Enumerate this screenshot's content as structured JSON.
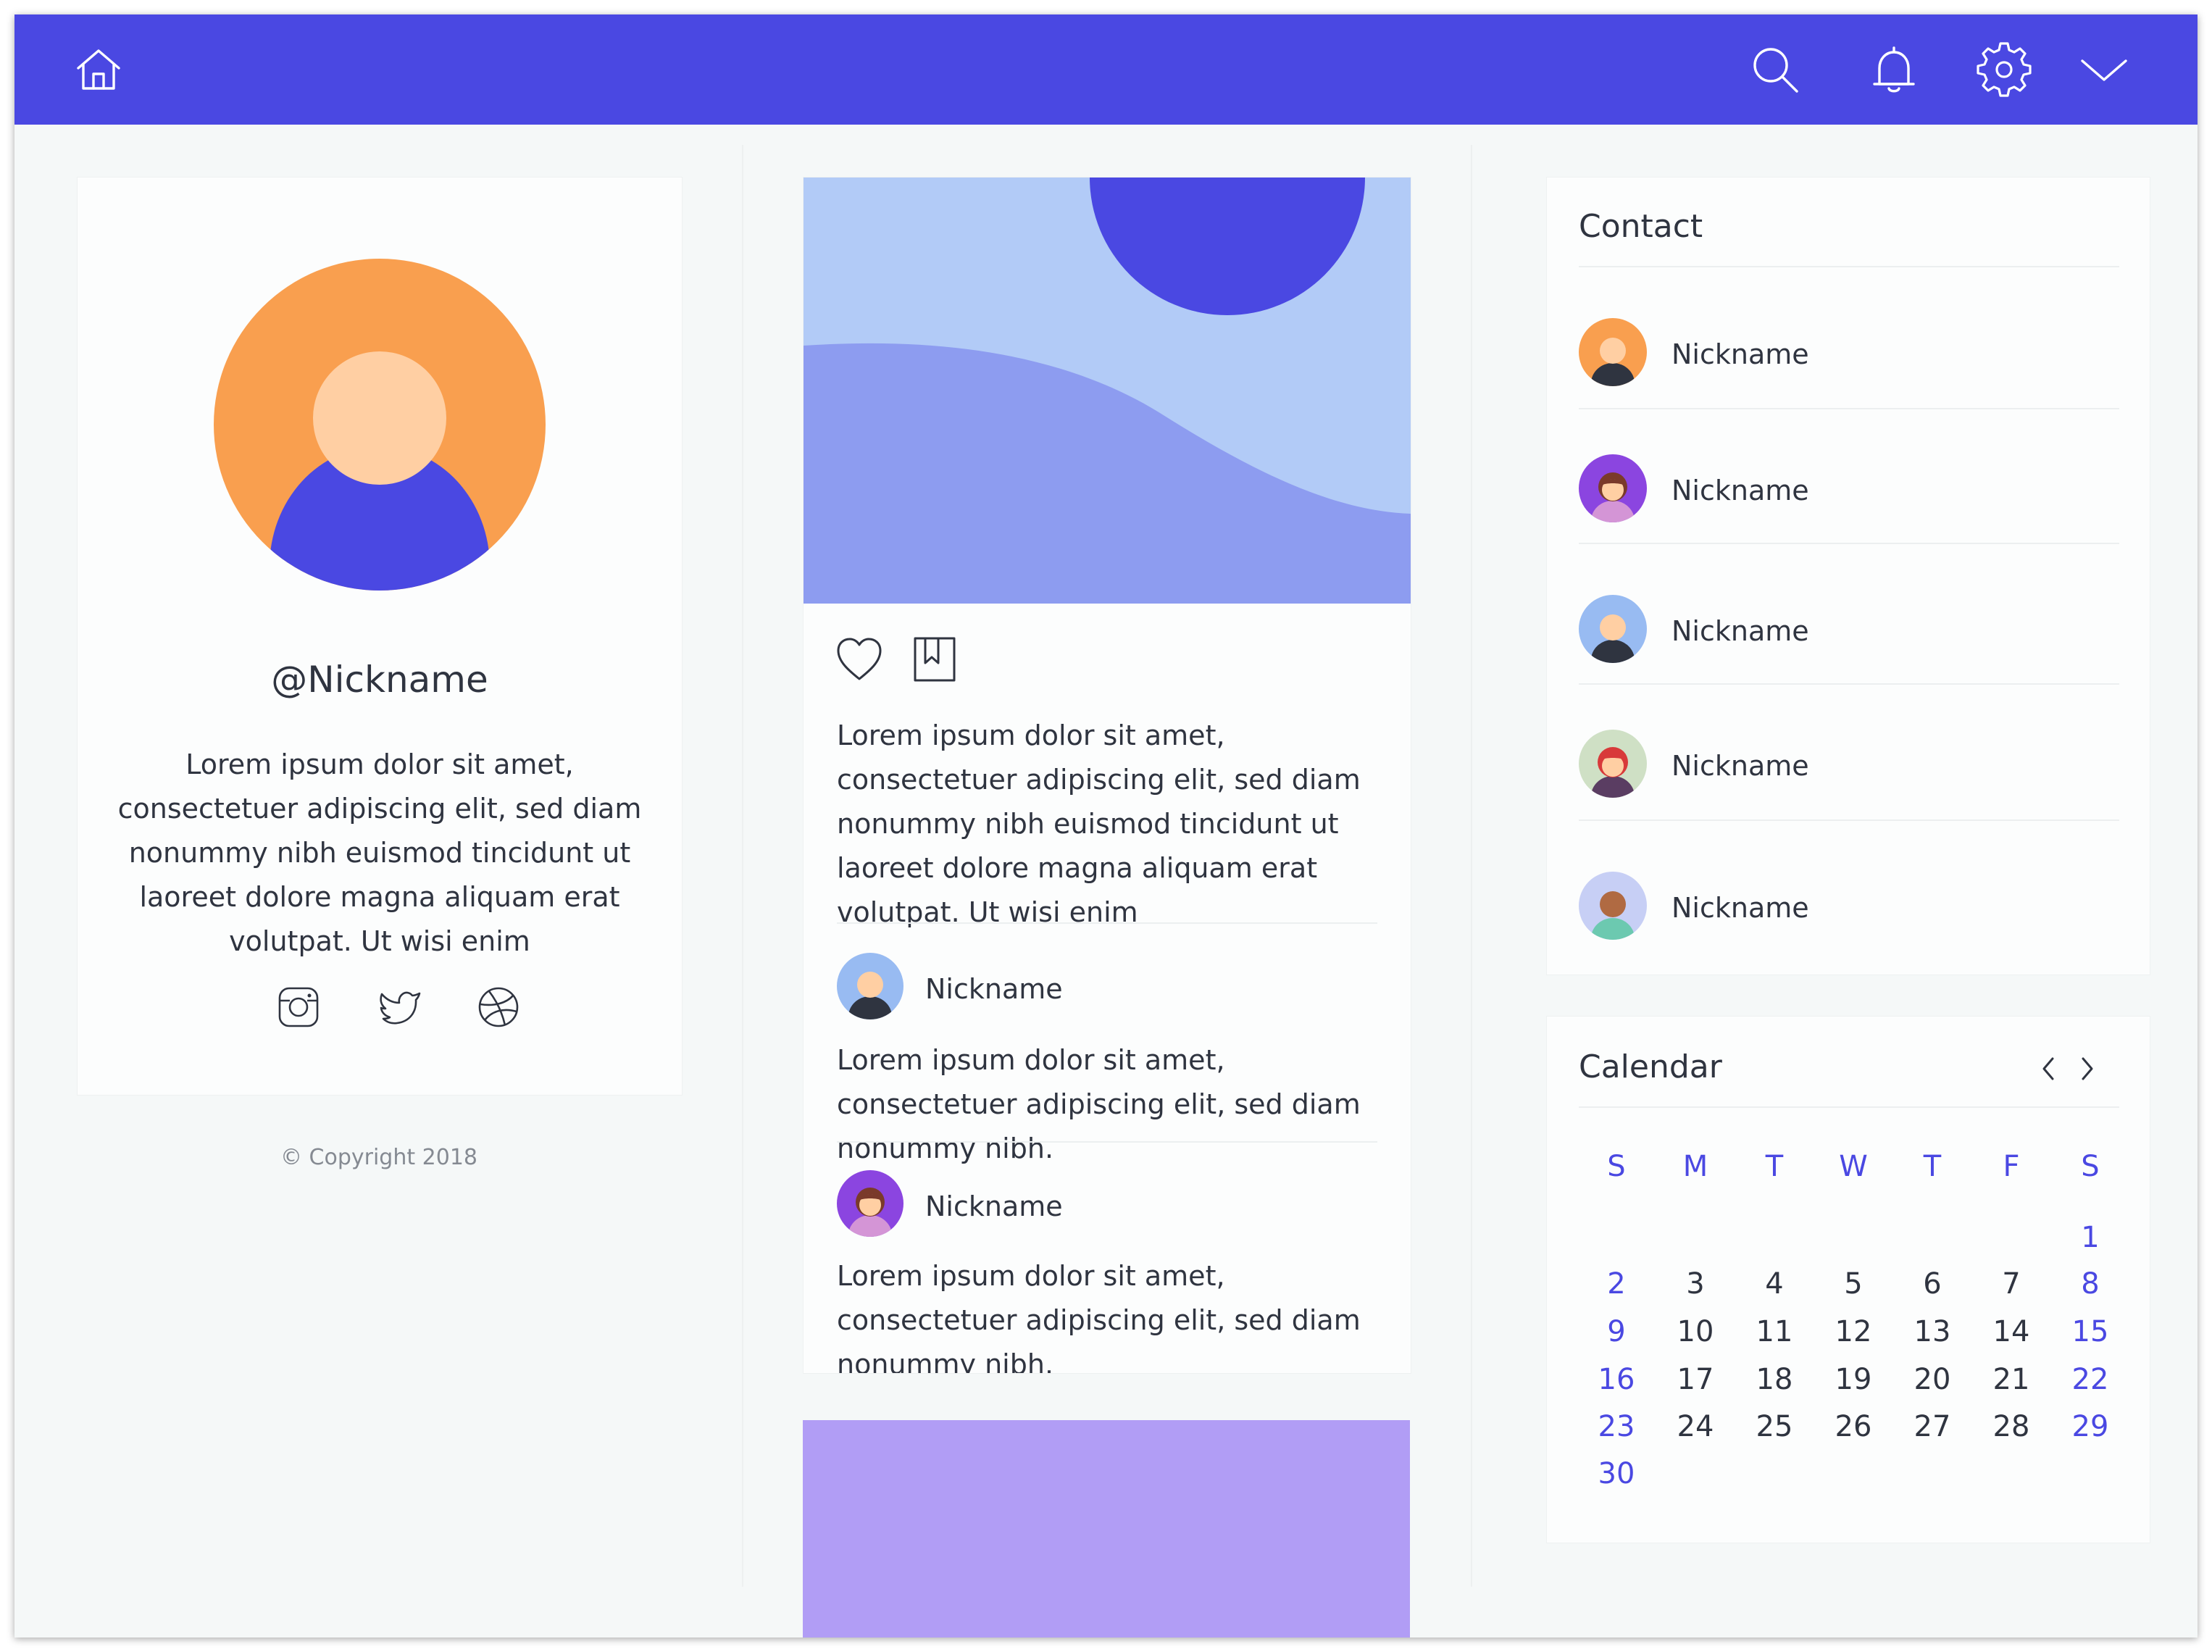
{
  "topbar": {
    "icons": [
      "home-icon",
      "search-icon",
      "bell-icon",
      "gear-icon",
      "chevron-down-icon"
    ],
    "color": "#4a48e2"
  },
  "profile": {
    "nickname": "@Nickname",
    "bio": "Lorem ipsum dolor sit amet, consectetuer adipiscing elit, sed diam nonummy nibh euismod tincidunt ut laoreet dolore magna aliquam erat volutpat. Ut wisi enim",
    "social": [
      "instagram-icon",
      "twitter-icon",
      "dribbble-icon"
    ]
  },
  "footer": {
    "copyright": "© Copyright 2018"
  },
  "post": {
    "text": "Lorem ipsum dolor sit amet, consectetuer adipiscing elit, sed diam nonummy nibh euismod tincidunt ut laoreet dolore magna aliquam erat volutpat. Ut wisi enim",
    "comments": [
      {
        "name": "Nickname",
        "text": "Lorem ipsum dolor sit amet, consectetuer adipiscing elit, sed diam nonummy nibh."
      },
      {
        "name": "Nickname",
        "text": "Lorem ipsum dolor sit amet, consectetuer adipiscing elit, sed diam nonummy nibh."
      }
    ]
  },
  "contact": {
    "title": "Contact",
    "items": [
      {
        "name": "Nickname"
      },
      {
        "name": "Nickname"
      },
      {
        "name": "Nickname"
      },
      {
        "name": "Nickname"
      },
      {
        "name": "Nickname"
      }
    ]
  },
  "calendar": {
    "title": "Calendar",
    "weekdays": [
      "S",
      "M",
      "T",
      "W",
      "T",
      "F",
      "S"
    ],
    "weeks": [
      [
        "",
        "",
        "",
        "",
        "",
        "",
        "1"
      ],
      [
        "2",
        "3",
        "4",
        "5",
        "6",
        "7",
        "8"
      ],
      [
        "9",
        "10",
        "11",
        "12",
        "13",
        "14",
        "15"
      ],
      [
        "16",
        "17",
        "18",
        "19",
        "20",
        "21",
        "22"
      ],
      [
        "23",
        "24",
        "25",
        "26",
        "27",
        "28",
        "29"
      ],
      [
        "30",
        "",
        "",
        "",
        "",
        "",
        ""
      ]
    ]
  }
}
